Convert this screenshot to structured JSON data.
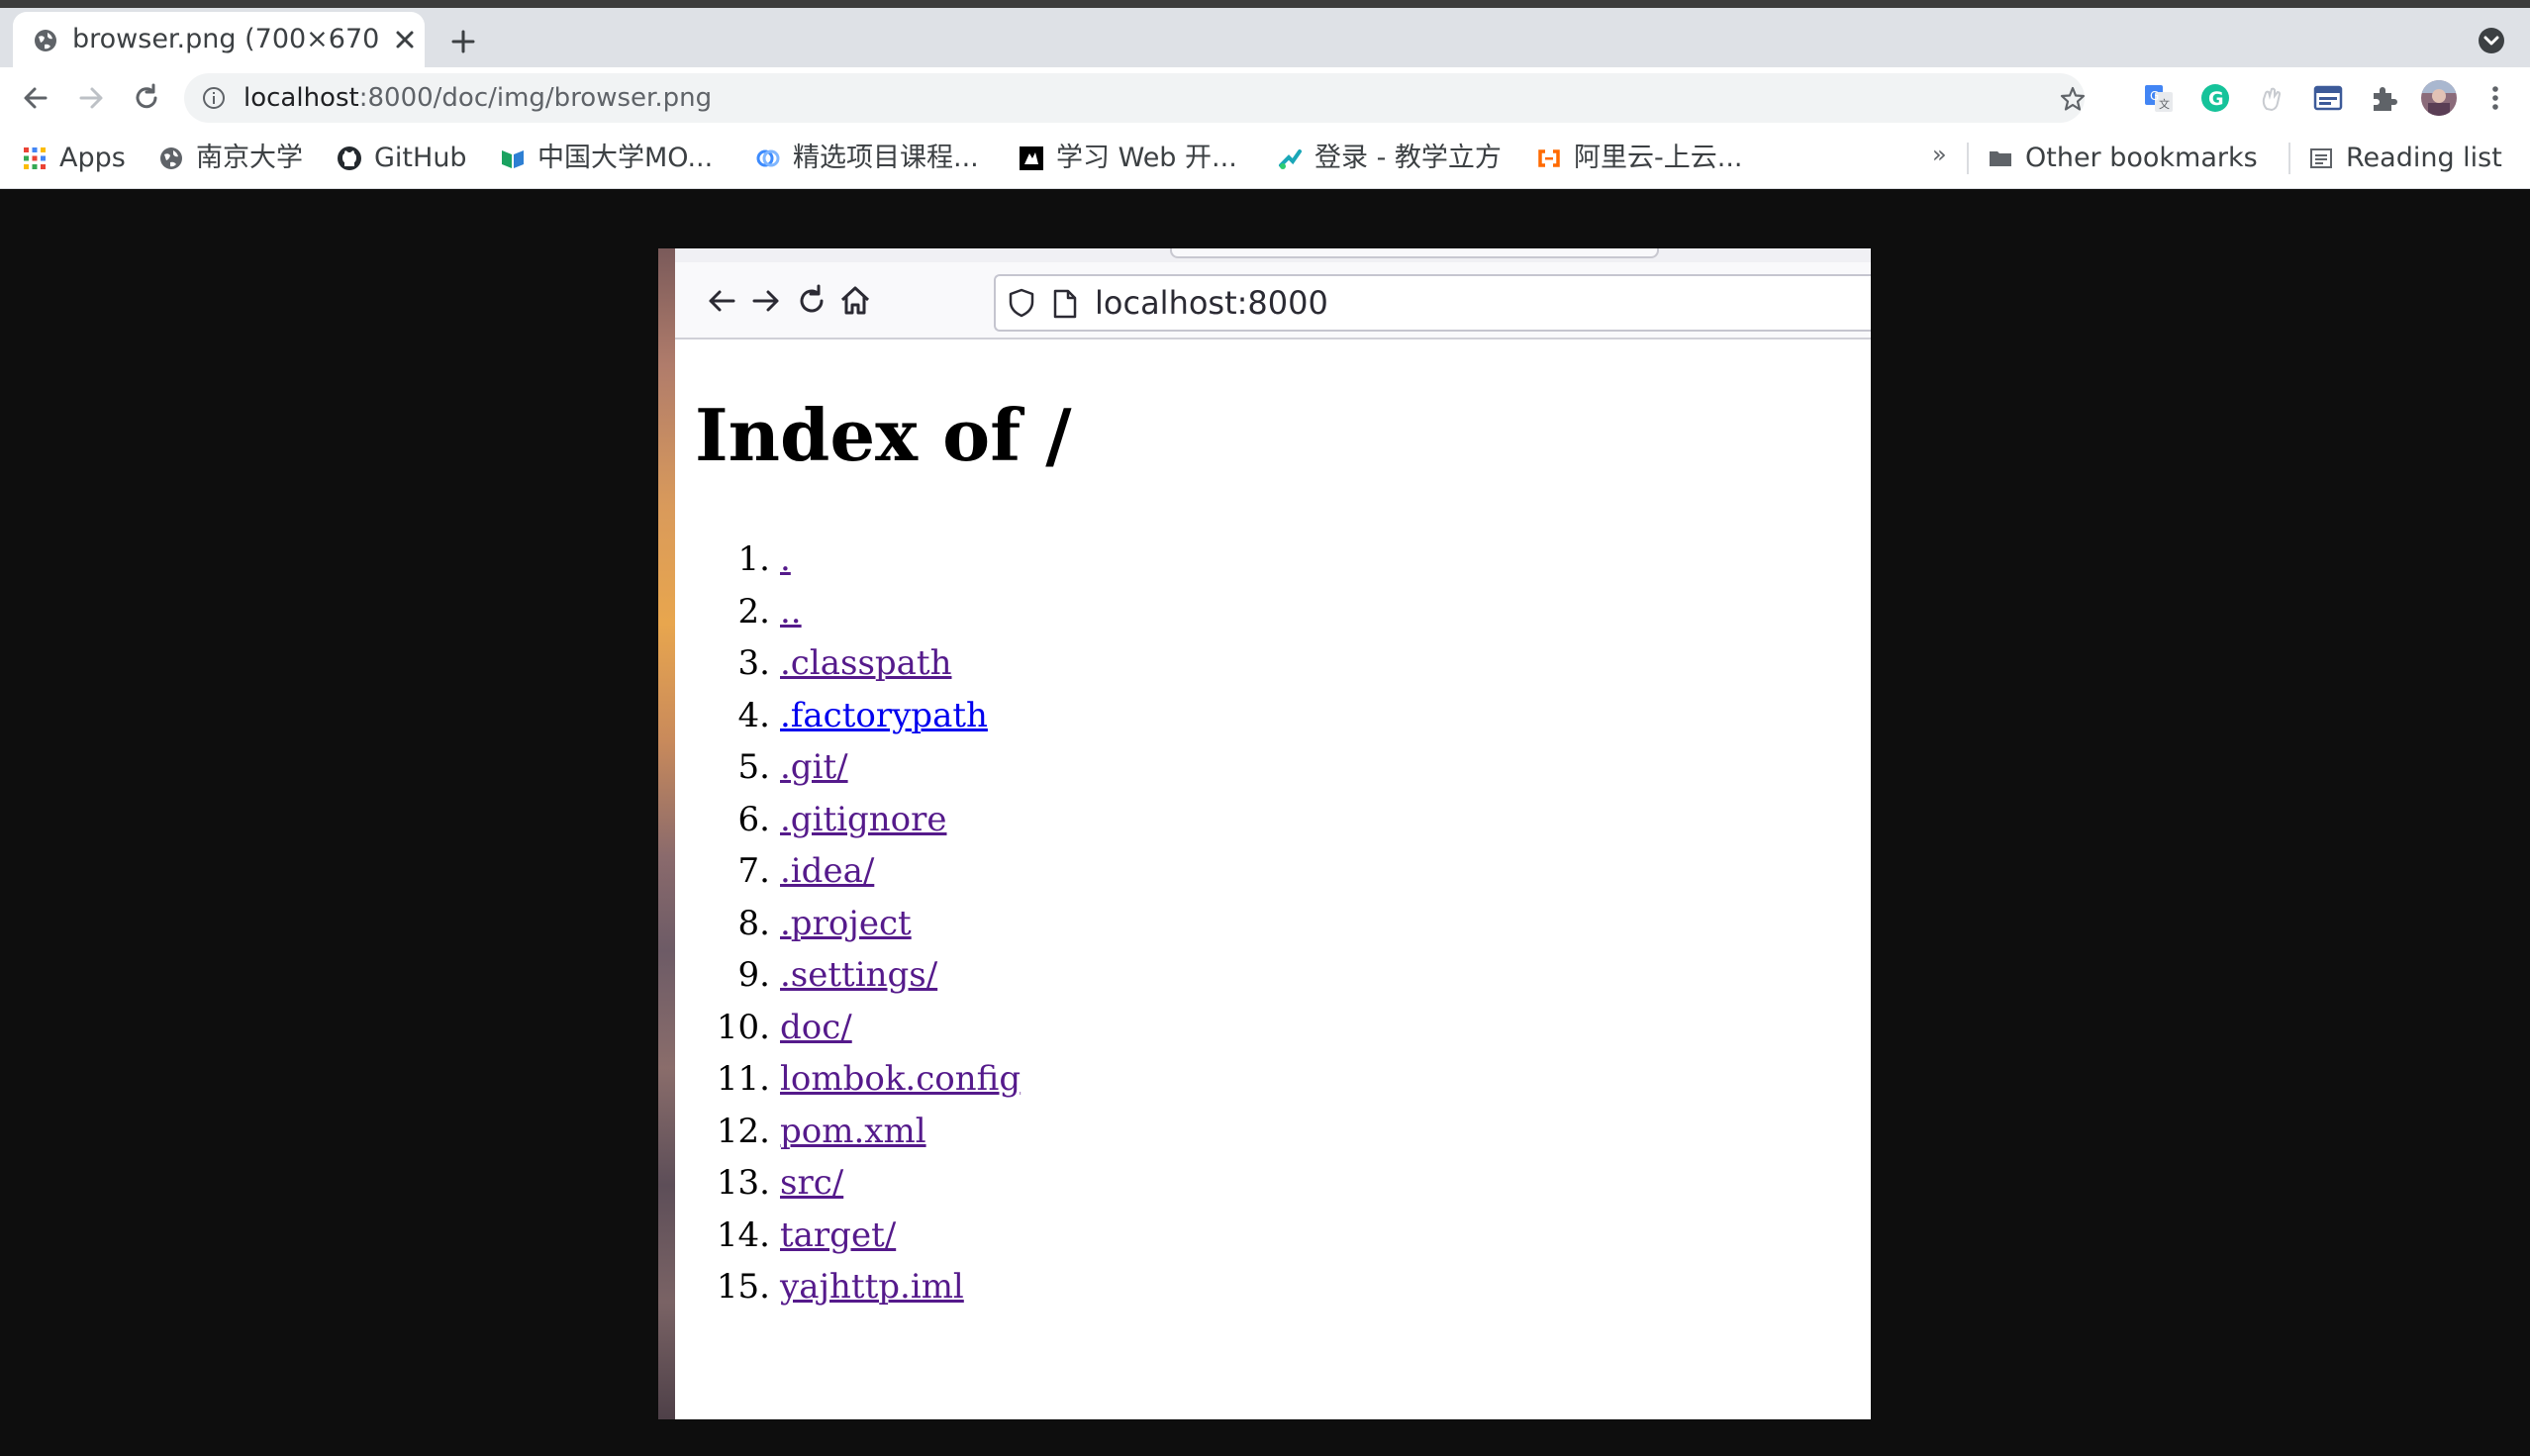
{
  "browser": {
    "tab": {
      "title": "browser.png (700×670 pixels)",
      "close_label": "×"
    },
    "omnibox": {
      "host": "localhost",
      "path": ":8000/doc/img/browser.png"
    },
    "bookmarks": [
      {
        "label": "Apps",
        "icon": "apps-grid-icon"
      },
      {
        "label": "南京大学",
        "icon": "globe-icon"
      },
      {
        "label": "GitHub",
        "icon": "github-icon"
      },
      {
        "label": "中国大学MO...",
        "icon": "mooc-icon"
      },
      {
        "label": "精选项目课程...",
        "icon": "course-icon"
      },
      {
        "label": "学习 Web 开...",
        "icon": "mdn-icon"
      },
      {
        "label": "登录 - 教学立方",
        "icon": "teaching-icon"
      },
      {
        "label": "阿里云-上云...",
        "icon": "aliyun-icon"
      }
    ],
    "bookmarks_overflow": "»",
    "other_bookmarks": "Other bookmarks",
    "reading_list": "Reading list"
  },
  "image": {
    "url": "localhost:8000",
    "heading": "Index of /",
    "entries": [
      {
        "num": "1.",
        "name": "."
      },
      {
        "num": "2.",
        "name": ".."
      },
      {
        "num": "3.",
        "name": ".classpath"
      },
      {
        "num": "4.",
        "name": ".factorypath"
      },
      {
        "num": "5.",
        "name": ".git/"
      },
      {
        "num": "6.",
        "name": ".gitignore"
      },
      {
        "num": "7.",
        "name": ".idea/"
      },
      {
        "num": "8.",
        "name": ".project"
      },
      {
        "num": "9.",
        "name": ".settings/"
      },
      {
        "num": "10.",
        "name": "doc/"
      },
      {
        "num": "11.",
        "name": "lombok.config"
      },
      {
        "num": "12.",
        "name": "pom.xml"
      },
      {
        "num": "13.",
        "name": "src/"
      },
      {
        "num": "14.",
        "name": "target/"
      },
      {
        "num": "15.",
        "name": "yajhttp.iml"
      }
    ]
  },
  "colors": {
    "visited_link": "#551a8b",
    "unvisited_link": "#0000ee",
    "page_background": "#0e0e0e"
  }
}
